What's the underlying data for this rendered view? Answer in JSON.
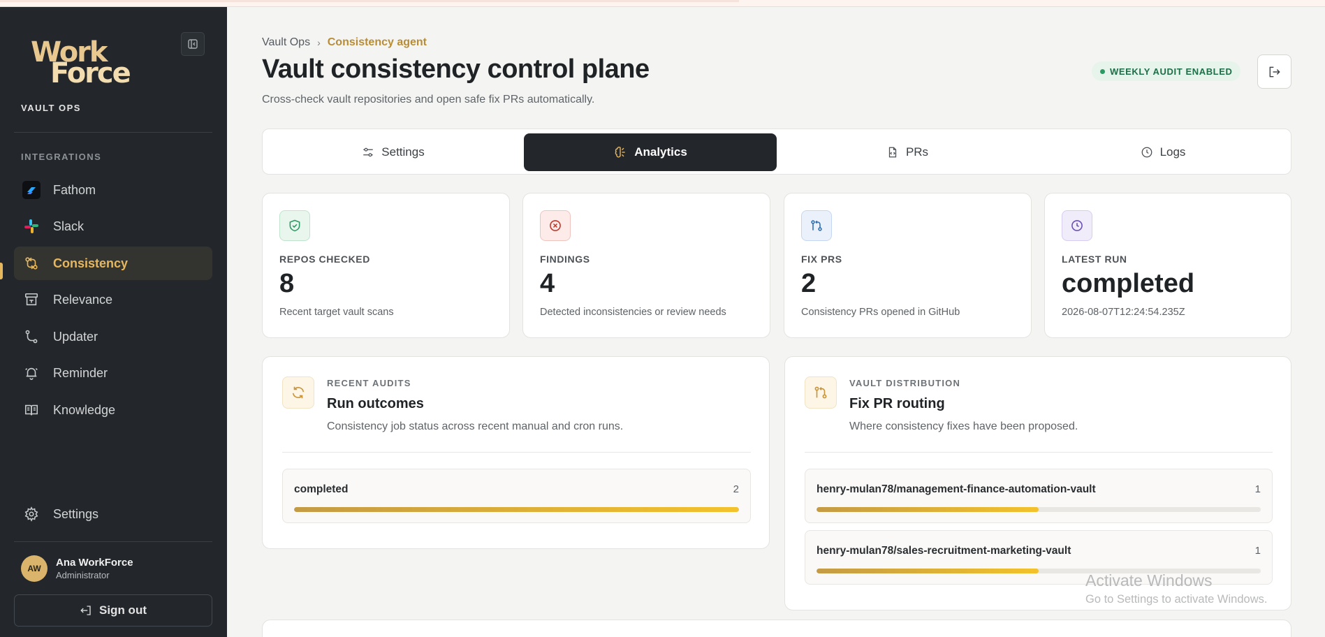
{
  "brand": {
    "logo_line1": "Work",
    "logo_line2": "Force",
    "workspace": "VAULT OPS"
  },
  "sidebar": {
    "section_label": "INTEGRATIONS",
    "items": [
      {
        "label": "Fathom",
        "icon": "fathom-logo-icon"
      },
      {
        "label": "Slack",
        "icon": "slack-logo-icon"
      },
      {
        "label": "Consistency",
        "icon": "git-compare-icon",
        "active": true
      },
      {
        "label": "Relevance",
        "icon": "archive-icon"
      },
      {
        "label": "Updater",
        "icon": "git-branch-icon"
      },
      {
        "label": "Reminder",
        "icon": "bell-icon"
      },
      {
        "label": "Knowledge",
        "icon": "book-icon"
      }
    ],
    "settings_label": "Settings"
  },
  "user": {
    "initials": "AW",
    "name": "Ana WorkForce",
    "role": "Administrator",
    "signout_label": "Sign out"
  },
  "header": {
    "breadcrumb": [
      "Vault Ops",
      "Consistency agent"
    ],
    "title": "Vault consistency control plane",
    "subtitle": "Cross-check vault repositories and open safe fix PRs automatically.",
    "badge": "WEEKLY AUDIT ENABLED"
  },
  "tabs": [
    {
      "label": "Settings",
      "icon": "sliders-icon"
    },
    {
      "label": "Analytics",
      "icon": "brain-icon",
      "active": true
    },
    {
      "label": "PRs",
      "icon": "file-code-icon"
    },
    {
      "label": "Logs",
      "icon": "clock-icon"
    }
  ],
  "stats": [
    {
      "label": "REPOS CHECKED",
      "value": "8",
      "note": "Recent target vault scans",
      "icon": "shield-check-icon",
      "color": "#2d9a63"
    },
    {
      "label": "FINDINGS",
      "value": "4",
      "note": "Detected inconsistencies or review needs",
      "icon": "x-circle-icon",
      "color": "#c0392b"
    },
    {
      "label": "FIX PRS",
      "value": "2",
      "note": "Consistency PRs opened in GitHub",
      "icon": "git-pull-request-icon",
      "color": "#2f6fb5"
    },
    {
      "label": "LATEST RUN",
      "value": "completed",
      "note": "2026-08-07T12:24:54.235Z",
      "icon": "clock-icon",
      "color": "#6a4fb8"
    }
  ],
  "recent_audits": {
    "kicker": "RECENT AUDITS",
    "title": "Run outcomes",
    "desc": "Consistency job status across recent manual and cron runs.",
    "rows": [
      {
        "label": "completed",
        "count": "2",
        "fraction": 1.0
      }
    ]
  },
  "vault_distribution": {
    "kicker": "VAULT DISTRIBUTION",
    "title": "Fix PR routing",
    "desc": "Where consistency fixes have been proposed.",
    "rows": [
      {
        "label": "henry-mulan78/management-finance-automation-vault",
        "count": "1",
        "fraction": 0.5
      },
      {
        "label": "henry-mulan78/sales-recruitment-marketing-vault",
        "count": "1",
        "fraction": 0.5
      }
    ]
  },
  "watermark": {
    "line1": "Activate Windows",
    "line2": "Go to Settings to activate Windows."
  },
  "colors": {
    "accent": "#e7b75e",
    "sidebar_bg": "#23272b",
    "badge_green": "#2d9a63"
  }
}
